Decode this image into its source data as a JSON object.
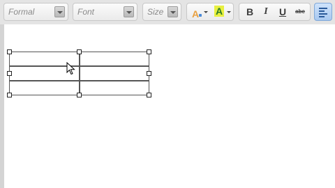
{
  "toolbar": {
    "format_label": "Formal",
    "font_label": "Font",
    "size_label": "Size",
    "bold_label": "B",
    "italic_label": "I",
    "underline_label": "U",
    "strike_label": "abc",
    "text_color_label": "A",
    "highlight_label": "A"
  },
  "colors": {
    "text_color_icon": "#e8a040",
    "highlight_bg": "#e8f040",
    "active_button": "#a8c8f0"
  },
  "icons": [
    "chevron-down-icon",
    "text-color-icon",
    "highlight-icon",
    "align-left-icon",
    "mouse-cursor-icon"
  ]
}
